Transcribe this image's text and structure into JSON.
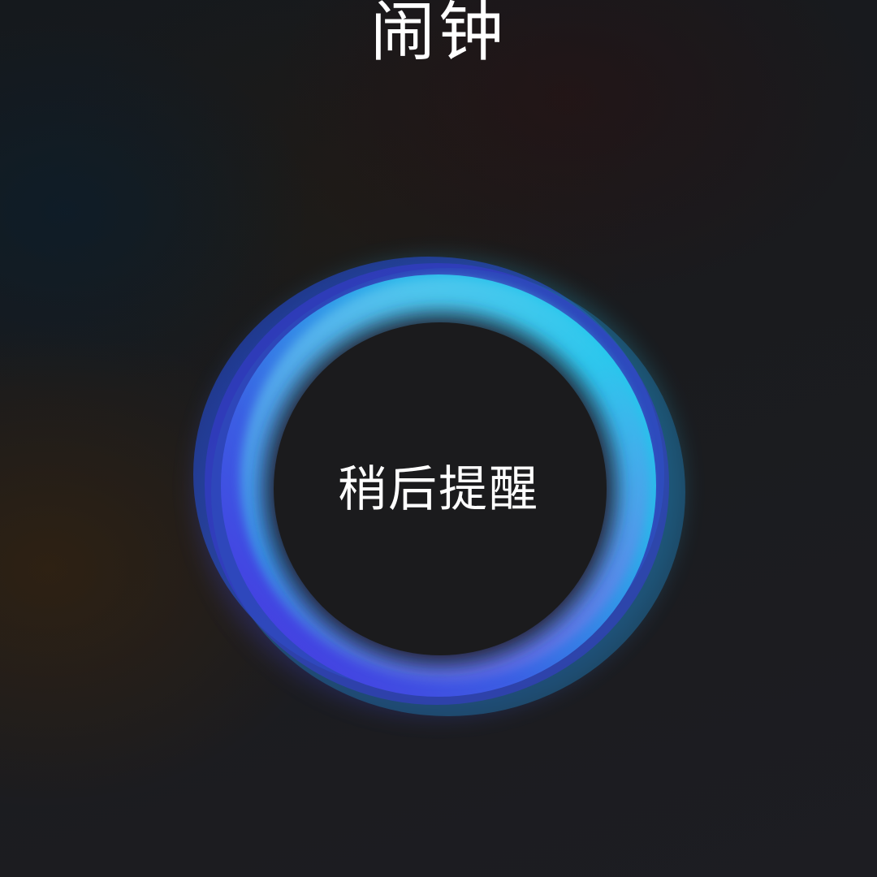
{
  "app": {
    "title": "闹钟"
  },
  "snooze_button": {
    "label": "稍后提醒"
  },
  "colors": {
    "ring_cyan": "#22d6ee",
    "ring_blue": "#3f5fe0",
    "ring_violet": "#6a4ee0",
    "text": "#ffffff",
    "center": "#1b1b1d"
  }
}
